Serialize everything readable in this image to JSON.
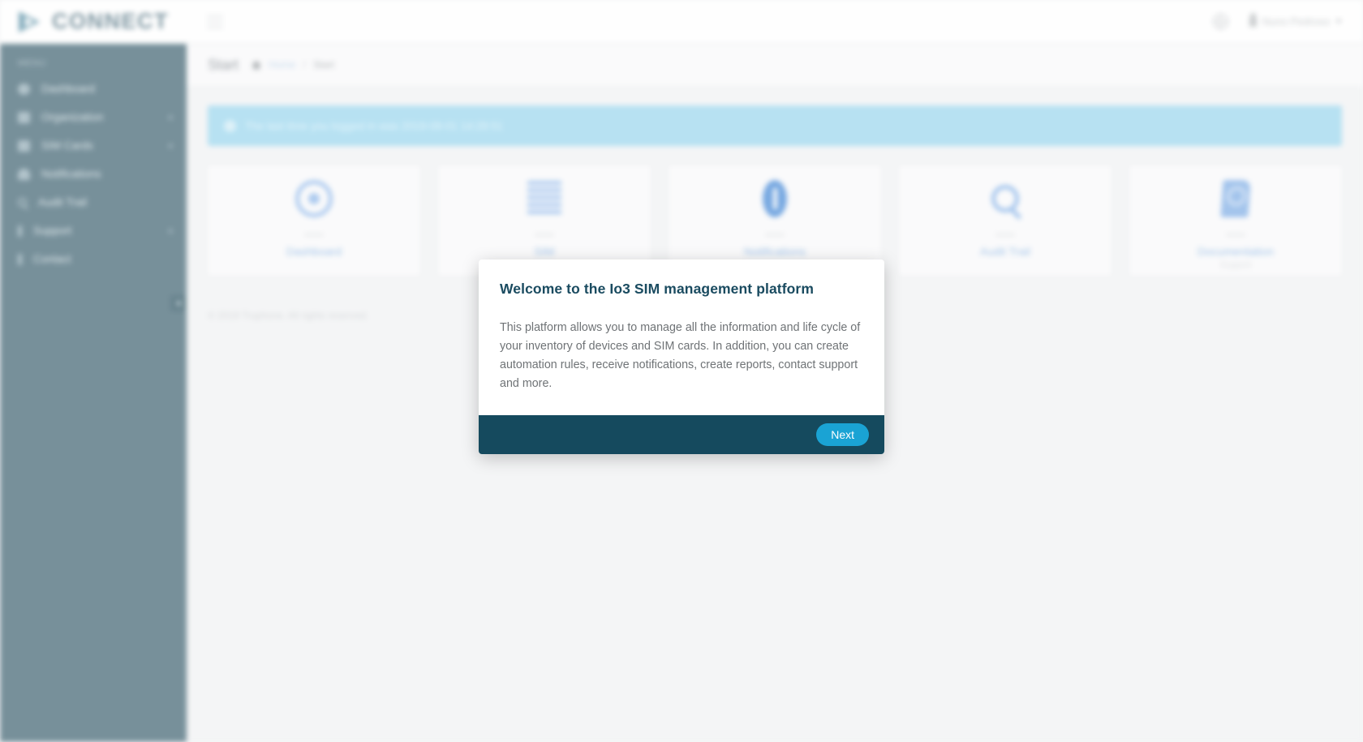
{
  "header": {
    "logo_text": "CONNECT",
    "menu_toggle": "hamburger-menu",
    "language_icon": "globe-icon",
    "user_name": "Nuno Pedroso"
  },
  "sidebar": {
    "section_label": "MENU",
    "items": [
      {
        "label": "Dashboard",
        "icon": "speedometer-icon",
        "expandable": ""
      },
      {
        "label": "Organization",
        "icon": "building-icon",
        "expandable": "+"
      },
      {
        "label": "SIM Cards",
        "icon": "sim-card-icon",
        "expandable": "+"
      },
      {
        "label": "Notifications",
        "icon": "bell-icon",
        "expandable": ""
      },
      {
        "label": "Audit Trail",
        "icon": "magnifier-icon",
        "expandable": ""
      },
      {
        "label": "Support",
        "icon": "lifebuoy-icon",
        "expandable": "+"
      },
      {
        "label": "Contact",
        "icon": "envelope-icon",
        "expandable": ""
      }
    ]
  },
  "page": {
    "title": "Start",
    "breadcrumb": {
      "home": "Home",
      "separator": "/",
      "current": "Start"
    },
    "banner": {
      "icon": "info-circle-icon",
      "text": "The last time you logged in was 2019-08-01 14:28:51"
    },
    "cards": [
      {
        "icon": "gauge-icon",
        "count": "••••••",
        "title": "Dashboard",
        "subtitle": ""
      },
      {
        "icon": "list-icon",
        "count": "••••••",
        "title": "SIM",
        "subtitle": ""
      },
      {
        "icon": "info-icon",
        "count": "••••••",
        "title": "Notifications",
        "subtitle": ""
      },
      {
        "icon": "search-icon",
        "count": "••••••",
        "title": "Audit Trail",
        "subtitle": ""
      },
      {
        "icon": "book-icon",
        "count": "••••••",
        "title": "Documentation",
        "subtitle": "Support"
      }
    ],
    "footer": "© 2019 Truphone. All rights reserved."
  },
  "modal": {
    "title": "Welcome to the Io3 SIM management platform",
    "body": "This platform allows you to manage all the information and life cycle of your inventory of devices and SIM cards. In addition, you can create automation rules, receive notifications, create reports, contact support and more.",
    "next_label": "Next"
  },
  "colors": {
    "sidebar": "#6d8893",
    "modal_footer": "#154a5e",
    "accent_button": "#1aa3d4",
    "modal_title": "#1a4b60",
    "banner": "#b2e0f2"
  }
}
